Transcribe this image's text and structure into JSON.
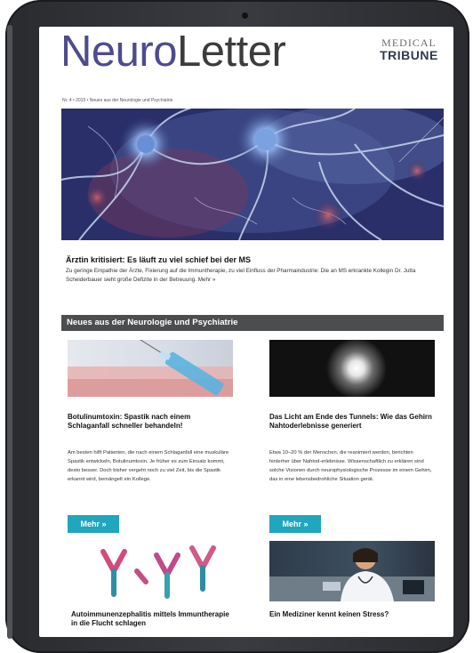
{
  "masthead": {
    "title_part1": "Neuro",
    "title_part2": "Letter"
  },
  "logo": {
    "line1": "MEDICAL",
    "line2": "TRIBUNE"
  },
  "issue_line": "Nr. 4 • 2019 • Neues aus der Neurologie und Psychiatrie",
  "hero": {
    "title": "Ärztin kritisiert: Es läuft zu viel schief bei der MS",
    "text": "Zu geringe Empathie der Ärzte, Fixierung auf die Immuntherapie, zu viel Einfluss der Pharmaindustrie: Die an MS erkrankte Kollegin Dr. Jutta Scheiderbauer sieht große Defizite in der Betreuung. Mehr »"
  },
  "section": {
    "title": "Neues aus der Neurologie und Psychiatrie"
  },
  "articles": [
    {
      "title": "Botulinumtoxin: Spastik nach einem Schlaganfall schneller behandeln!",
      "text": "Am besten hilft Patienten, die nach einem Schlaganfall eine muskuläre Spastik entwickeln, Botulinumtoxin. Je früher es zum Einsatz kommt, desto besser. Doch bisher vergeht noch zu viel Zeit, bis die Spastik erkannt wird, bemängelt ein Kollege.",
      "button": "Mehr »"
    },
    {
      "title": "Das Licht am Ende des Tunnels: Wie das Gehirn Nahtoderlebnisse generiert",
      "text": "Etwa 10–20 % der Menschen, die reanimiert werden, berichten hinterher über Nahtod-erlebnisse. Wissenschaftlich zu erklären sind solche Visionen durch neurophysiologische Prozesse im einem Gehirn, das in eine lebensbedrohliche Situation gerät.",
      "button": "Mehr »"
    },
    {
      "title": "Autoimmunenzephalitis mittels Immuntherapie in die Flucht schlagen",
      "text": "",
      "button": ""
    },
    {
      "title": "Ein Mediziner kennt keinen Stress?",
      "text": "",
      "button": ""
    }
  ],
  "colors": {
    "masthead_neuro": "#4f4b8f",
    "masthead_letter": "#3c3c3e",
    "section_bar": "#4c4d4f",
    "button": "#20a6bd"
  }
}
